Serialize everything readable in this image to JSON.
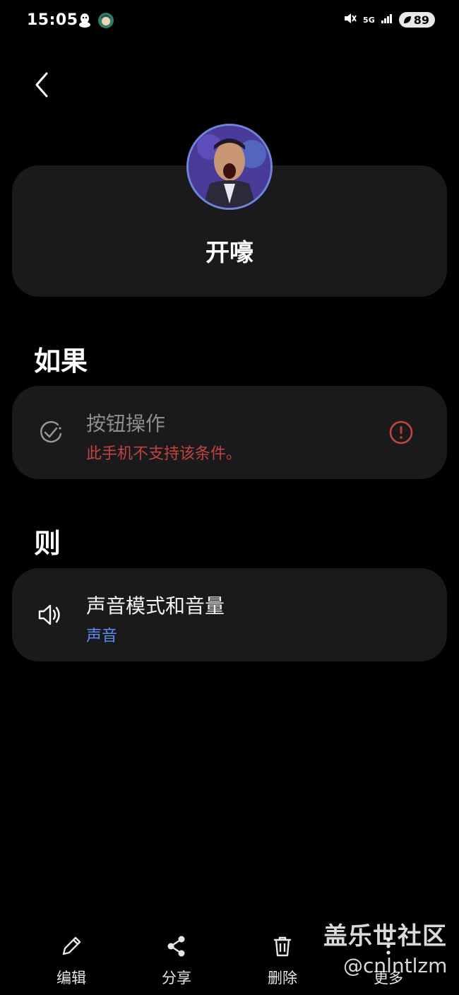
{
  "status_bar": {
    "time": "15:05",
    "network": "5G",
    "battery": "89"
  },
  "routine": {
    "name": "开嚎"
  },
  "if_section": {
    "title": "如果",
    "condition_title": "按钮操作",
    "condition_error": "此手机不支持该条件。"
  },
  "then_section": {
    "title": "则",
    "action_title": "声音模式和音量",
    "action_subtitle": "声音"
  },
  "bottom_bar": {
    "edit": "编辑",
    "share": "分享",
    "delete": "删除",
    "more": "更多"
  },
  "watermark": {
    "brand": "盖乐世社区",
    "user": "@cnlntlzm"
  },
  "colors": {
    "background": "#000000",
    "card": "#1a1a1c",
    "error": "#c1443d",
    "accent_blue": "#5b8cf0"
  }
}
